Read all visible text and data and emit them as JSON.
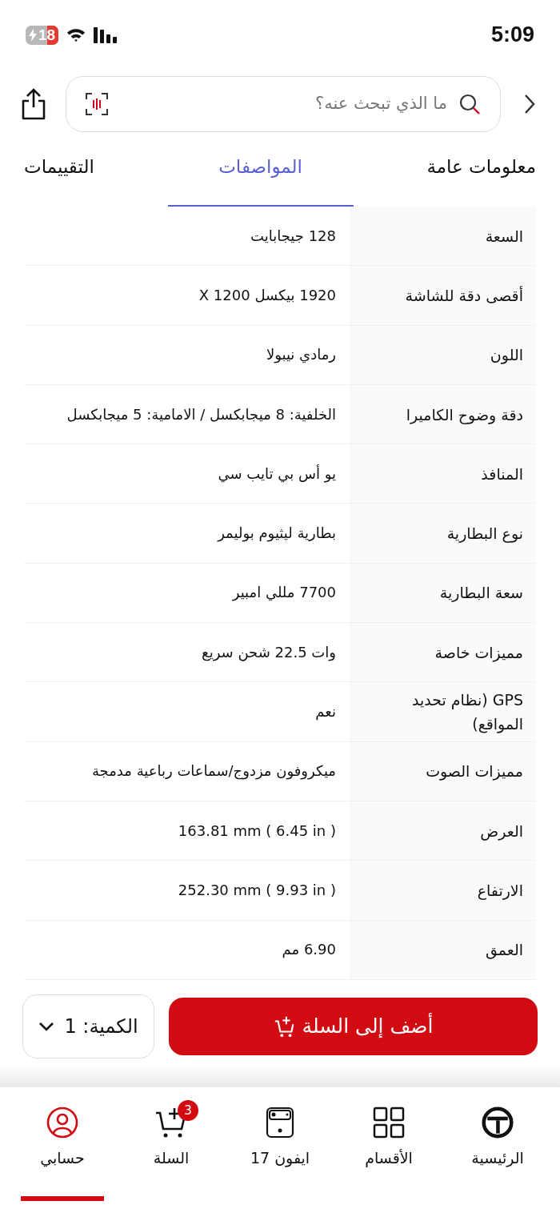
{
  "status_bar": {
    "time": "5:09",
    "battery": "18"
  },
  "search": {
    "placeholder": "ما الذي تبحث عنه؟"
  },
  "tabs": [
    {
      "label": "معلومات عامة",
      "selected": false
    },
    {
      "label": "المواصفات",
      "selected": true
    },
    {
      "label": "التقييمات",
      "selected": false
    }
  ],
  "specs": [
    {
      "label": "السعة",
      "value": "128 جيجابايت"
    },
    {
      "label": "أقصى دقة للشاشة",
      "value": "1920 بيكسل X 1200"
    },
    {
      "label": "اللون",
      "value": "رمادي نيبولا"
    },
    {
      "label": "دقة وضوح الكاميرا",
      "value": "الخلفية: 8 ميجابكسل / الامامية: 5 ميجابكسل"
    },
    {
      "label": "المنافذ",
      "value": "يو أس  بي تايب سي"
    },
    {
      "label": "نوع البطارية",
      "value": "بطارية ليثيوم بوليمر"
    },
    {
      "label": "سعة البطارية",
      "value": "7700 مللي امبير"
    },
    {
      "label": "مميزات خاصة",
      "value": "وات 22.5 شحن سريع"
    },
    {
      "label": "GPS (نظام تحديد المواقع)",
      "value": "نعم"
    },
    {
      "label": "مميزات الصوت",
      "value": "ميكروفون مزدوج/سماعات رباعية مدمجة"
    },
    {
      "label": "العرض",
      "value": "163.81 mm ( 6.45 in )"
    },
    {
      "label": "الارتفاع",
      "value": "252.30 mm ( 9.93 in )"
    },
    {
      "label": "العمق",
      "value": "6.90 مم"
    }
  ],
  "quantity": "الكمية: 1",
  "add_to_cart": "أضف إلى السلة",
  "nav": [
    {
      "kind": "home",
      "label": "الرئيسية",
      "selected": false
    },
    {
      "kind": "categories",
      "label": "الأقسام",
      "selected": false
    },
    {
      "kind": "phone",
      "label": "ايفون 17",
      "selected": false
    },
    {
      "kind": "cart",
      "label": "السلة",
      "selected": false,
      "badge": "3"
    },
    {
      "kind": "account",
      "label": "حسابي",
      "selected": true
    }
  ]
}
